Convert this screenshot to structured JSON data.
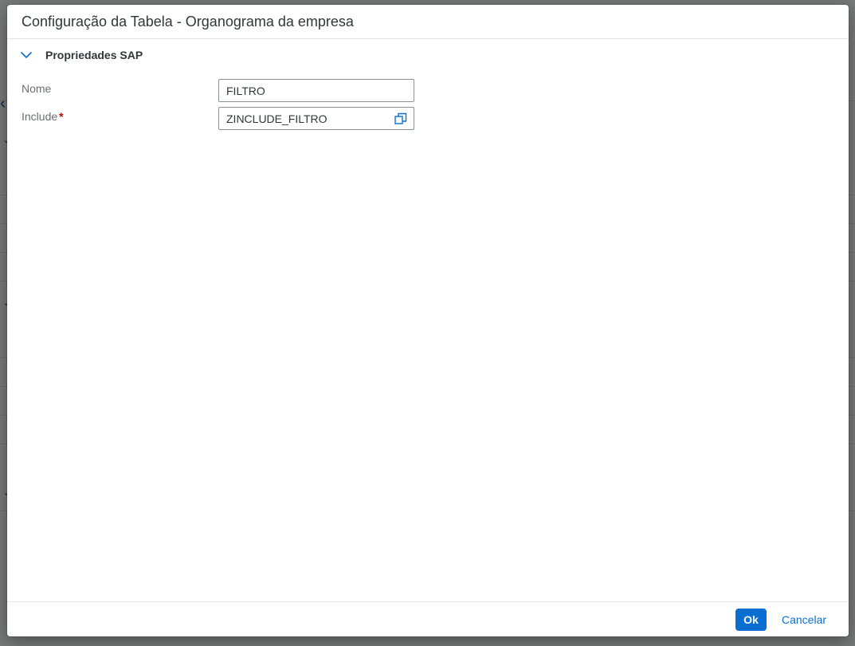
{
  "dialog": {
    "title": "Configuração da Tabela - Organograma da empresa"
  },
  "section": {
    "title": "Propriedades SAP",
    "chevron_icon": "chevron-down-icon"
  },
  "form": {
    "nome": {
      "label": "Nome",
      "value": "FILTRO"
    },
    "include": {
      "label": "Include",
      "required_marker": "*",
      "value": "ZINCLUDE_FILTRO",
      "value_help_icon": "value-help-icon"
    }
  },
  "footer": {
    "ok_label": "Ok",
    "cancel_label": "Cancelar"
  },
  "colors": {
    "accent": "#0a6ed1",
    "required": "#bb0000",
    "text": "#32363a",
    "label": "#6a6d70"
  }
}
